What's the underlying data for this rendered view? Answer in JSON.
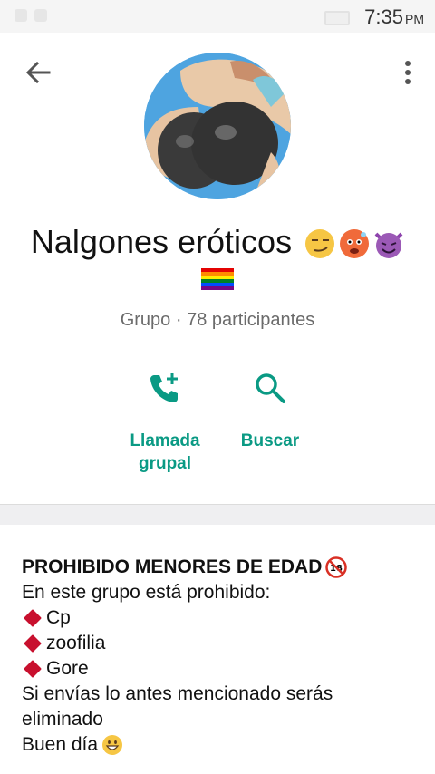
{
  "status_bar": {
    "time": "7:35",
    "ampm": "PM"
  },
  "header": {
    "back_icon": "arrow-left-icon",
    "menu_icon": "more-vert-icon",
    "group_name": "Nalgones eróticos",
    "subtitle": "Grupo · 78 participantes"
  },
  "actions": [
    {
      "label_1": "Llamada",
      "label_2": "grupal",
      "icon": "phone-add-icon"
    },
    {
      "label_1": "Buscar",
      "icon": "search-icon"
    }
  ],
  "description": {
    "title": "PROHIBIDO MENORES DE EDAD",
    "intro": "En este grupo está prohibido:",
    "items": [
      "Cp",
      "zoofilia",
      "Gore"
    ],
    "warning_1": "Si envías lo antes mencionado serás",
    "warning_2": "eliminado",
    "closing": "Buen día"
  },
  "colors": {
    "accent": "#0a9a84",
    "subtitle": "#6b6b6b",
    "diamond": "#c8102e"
  }
}
